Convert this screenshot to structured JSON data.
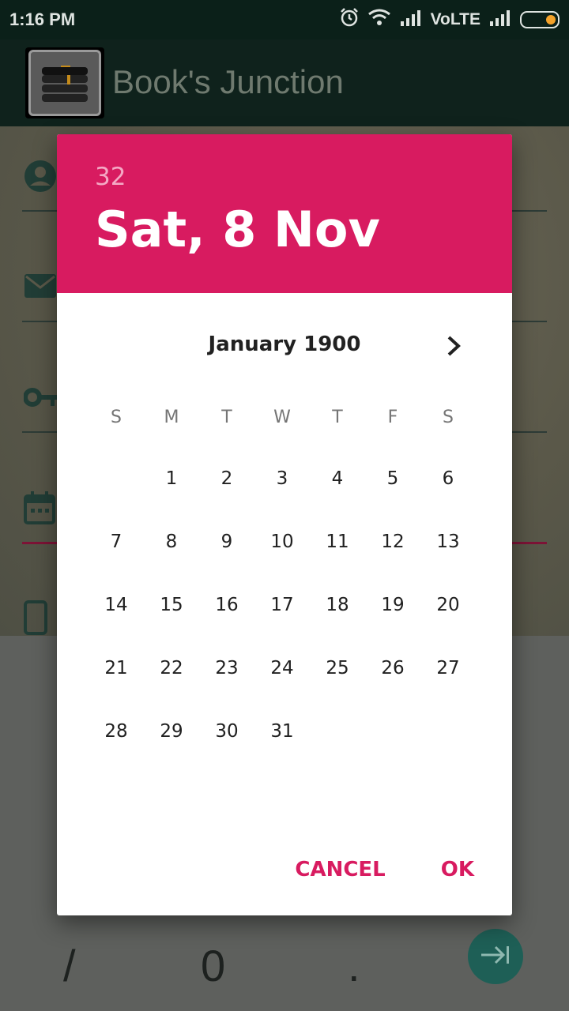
{
  "status_bar": {
    "time": "1:16 PM",
    "network_label": "VoLTE"
  },
  "app_bar": {
    "title": "Book's Junction"
  },
  "date_picker": {
    "year": "32",
    "selected_date": "Sat, 8 Nov",
    "month_label": "January 1900",
    "weekdays": [
      "S",
      "M",
      "T",
      "W",
      "T",
      "F",
      "S"
    ],
    "leading_blanks": 1,
    "days": [
      "1",
      "2",
      "3",
      "4",
      "5",
      "6",
      "7",
      "8",
      "9",
      "10",
      "11",
      "12",
      "13",
      "14",
      "15",
      "16",
      "17",
      "18",
      "19",
      "20",
      "21",
      "22",
      "23",
      "24",
      "25",
      "26",
      "27",
      "28",
      "29",
      "30",
      "31"
    ],
    "cancel_label": "CANCEL",
    "ok_label": "OK",
    "accent_color": "#d81b60"
  },
  "keyboard": {
    "keys": [
      "/",
      "0",
      "."
    ]
  }
}
